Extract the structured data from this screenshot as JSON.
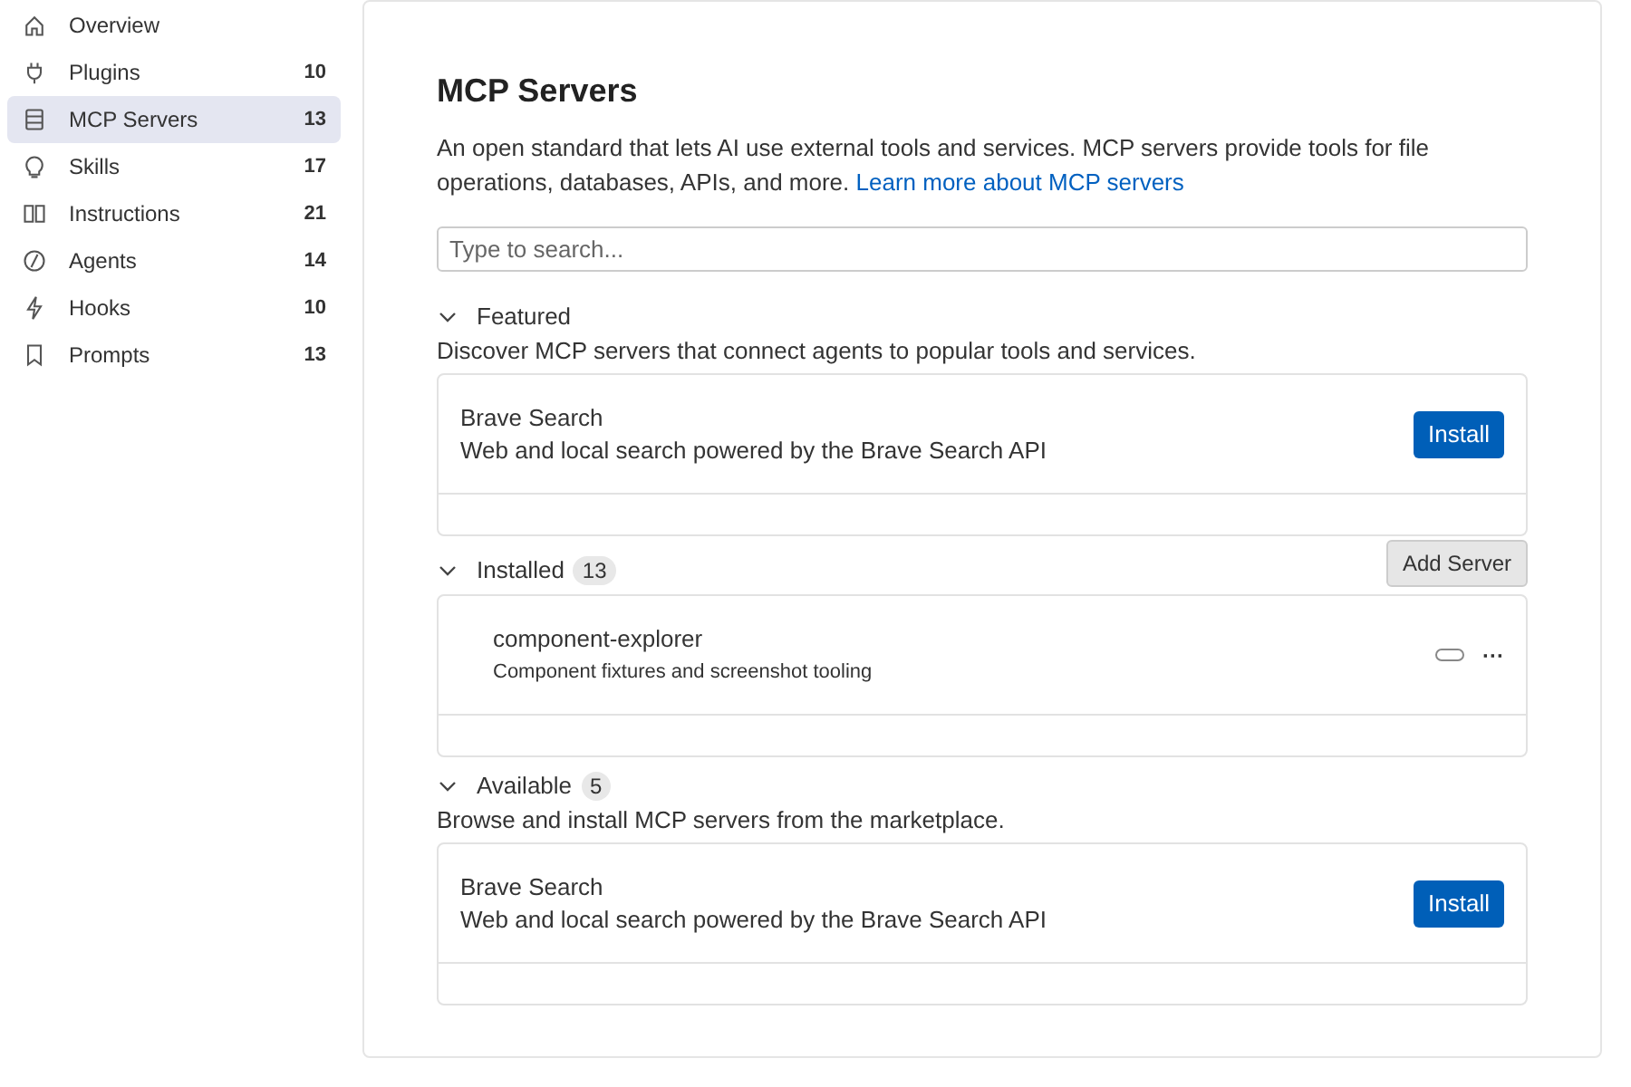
{
  "sidebar": {
    "items": [
      {
        "kind": "home",
        "label": "Overview",
        "selected": false
      },
      {
        "kind": "plug",
        "label": "Plugins",
        "count": "10",
        "selected": false
      },
      {
        "kind": "server",
        "label": "MCP Servers",
        "count": "13",
        "selected": true
      },
      {
        "kind": "bulb",
        "label": "Skills",
        "count": "17",
        "selected": false
      },
      {
        "kind": "book",
        "label": "Instructions",
        "count": "21",
        "selected": false
      },
      {
        "kind": "agent",
        "label": "Agents",
        "count": "14",
        "selected": false
      },
      {
        "kind": "bolt",
        "label": "Hooks",
        "count": "10",
        "selected": false
      },
      {
        "kind": "bookmark",
        "label": "Prompts",
        "count": "13",
        "selected": false
      }
    ]
  },
  "page": {
    "title": "MCP Servers",
    "description": "An open standard that lets AI use external tools and services. MCP servers provide tools for file operations, databases, APIs, and more.",
    "link": "Learn more about MCP servers"
  },
  "search": {
    "placeholder": "Type to search..."
  },
  "sections": [
    {
      "kind": "featured",
      "title": "Featured",
      "expanded": true,
      "subtitle": "Discover MCP servers that connect agents to popular tools and services.",
      "items": [
        {
          "name": "Brave Search",
          "description": "Web and local search powered by the Brave Search API",
          "action": "Install"
        }
      ]
    },
    {
      "kind": "installed",
      "title": "Installed",
      "count": "13",
      "expanded": true,
      "action": "Add Server",
      "items": [
        {
          "name": "component-explorer",
          "description": "Component fixtures and screenshot tooling",
          "on": false,
          "more": "···"
        }
      ]
    },
    {
      "kind": "available",
      "title": "Available",
      "count": "5",
      "expanded": true,
      "subtitle": "Browse and install MCP servers from the marketplace.",
      "items": [
        {
          "name": "Brave Search",
          "description": "Web and local search powered by the Brave Search API",
          "action": "Install"
        }
      ]
    }
  ]
}
